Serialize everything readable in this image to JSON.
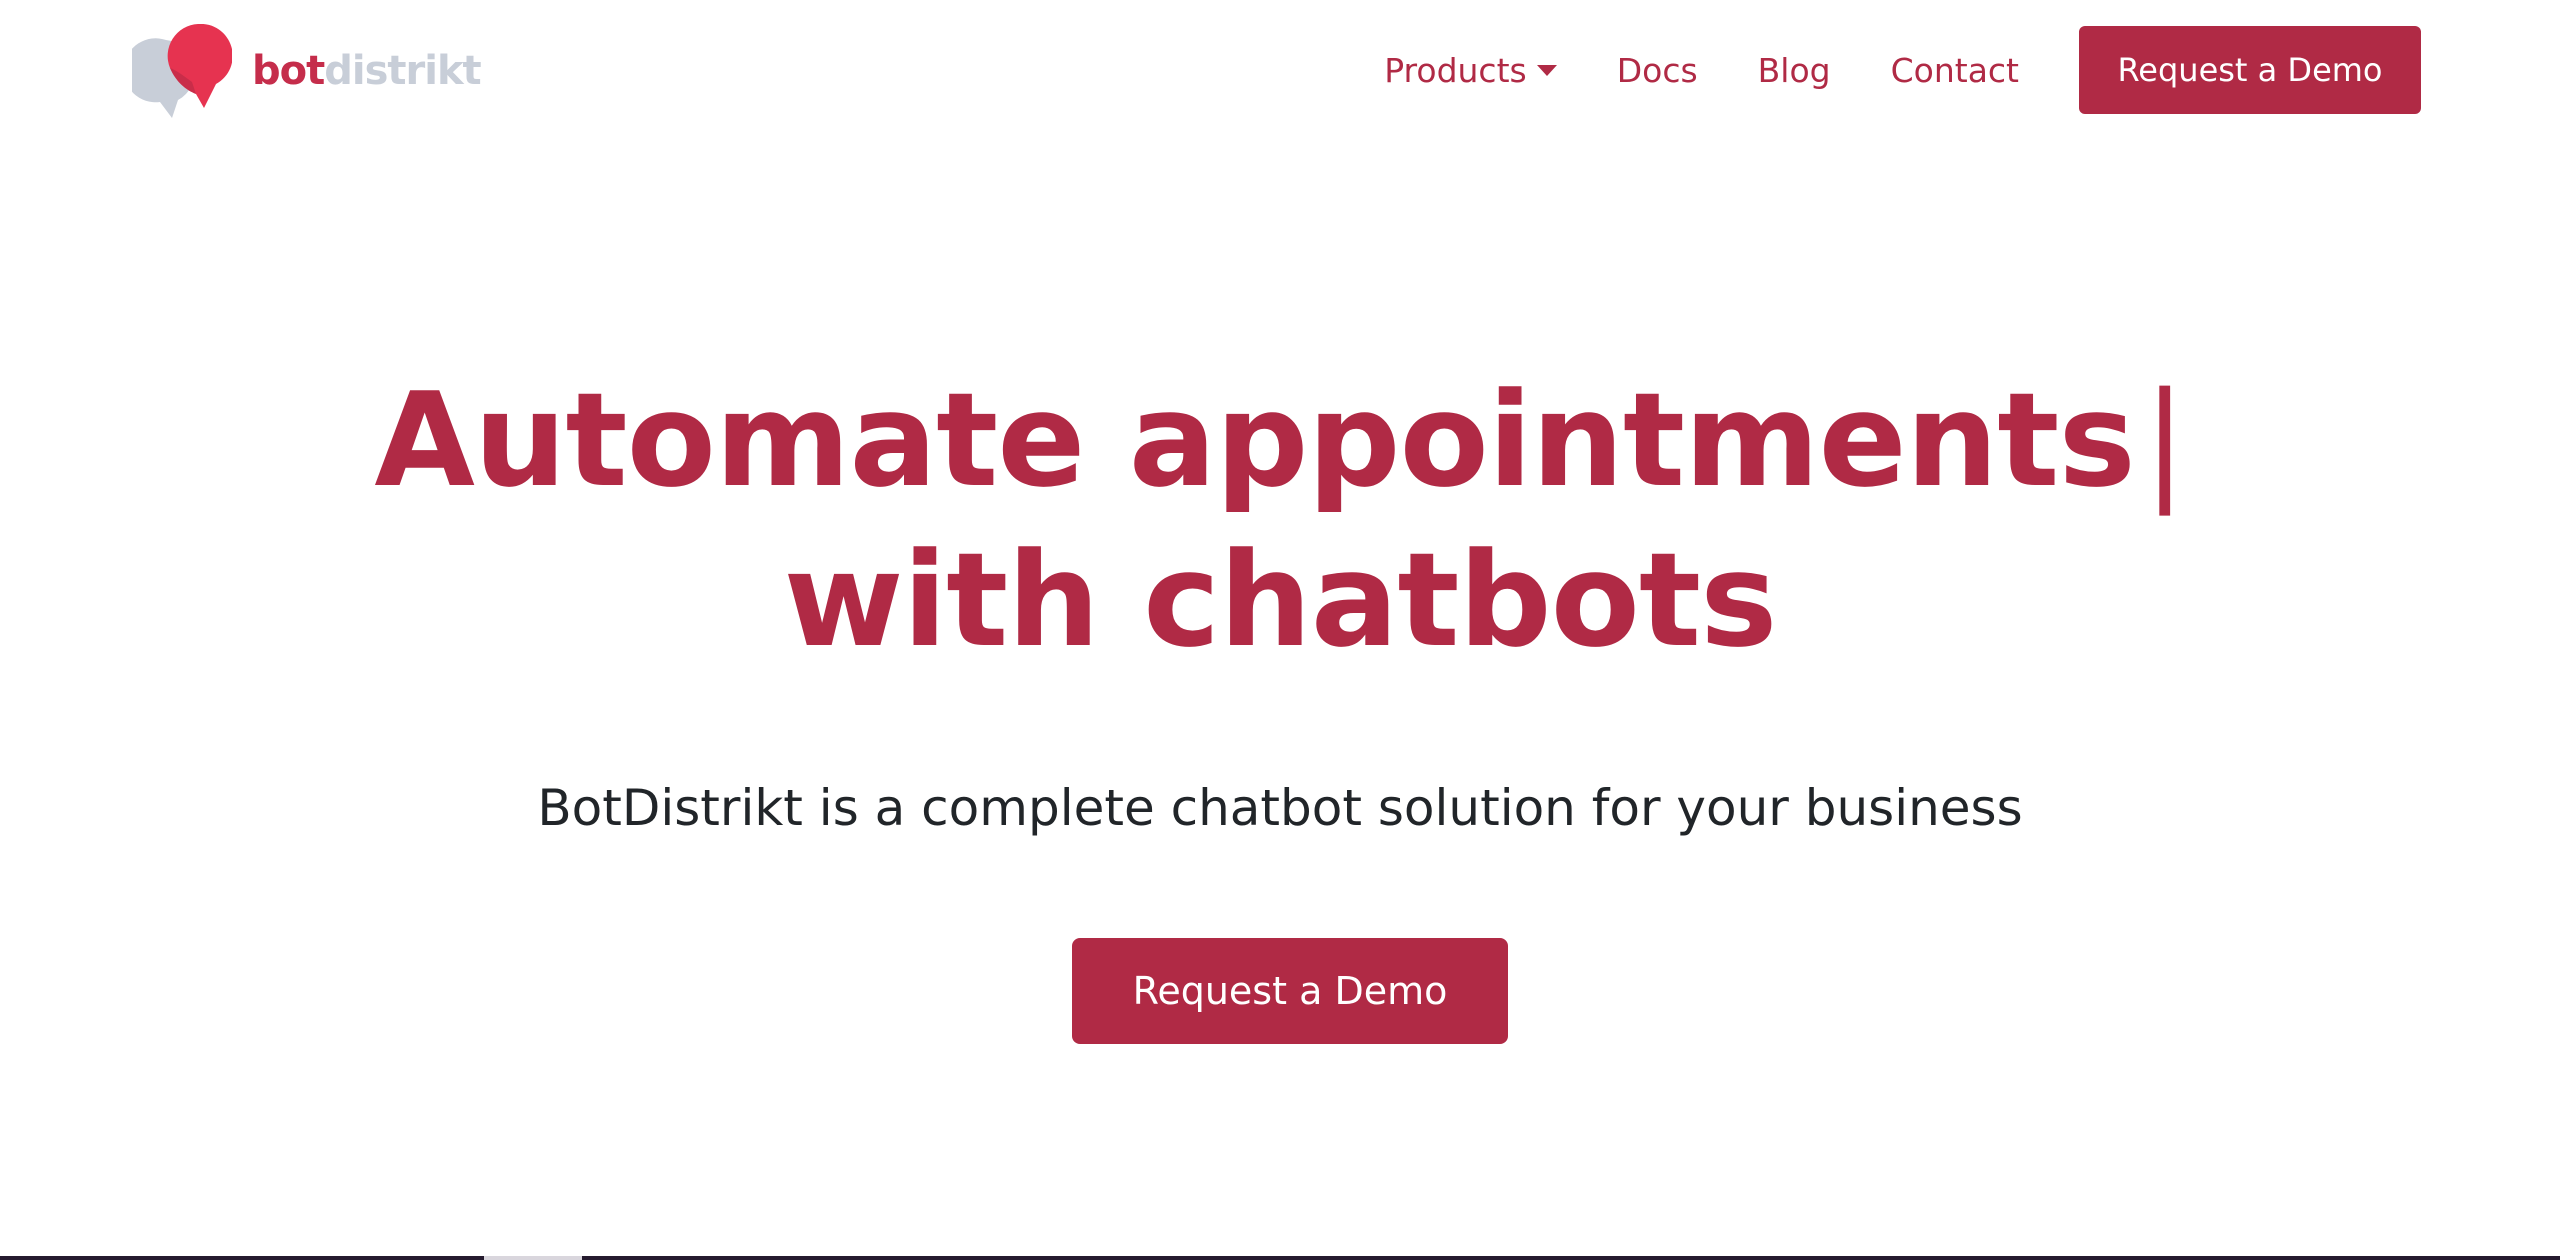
{
  "brand": {
    "name_part1": "bot",
    "name_part2": "distrikt",
    "primary_color": "#b02a45",
    "logo_red": "#e63350",
    "logo_gray": "#c8ced8"
  },
  "nav": {
    "items": [
      {
        "label": "Products",
        "has_dropdown": true
      },
      {
        "label": "Docs"
      },
      {
        "label": "Blog"
      },
      {
        "label": "Contact"
      }
    ],
    "cta_label": "Request a Demo"
  },
  "hero": {
    "title_line1": "Automate appointments",
    "title_cursor": "|",
    "title_line2": "with chatbots",
    "subtitle": "BotDistrikt is a complete chatbot solution for your business",
    "cta_label": "Request a Demo"
  }
}
